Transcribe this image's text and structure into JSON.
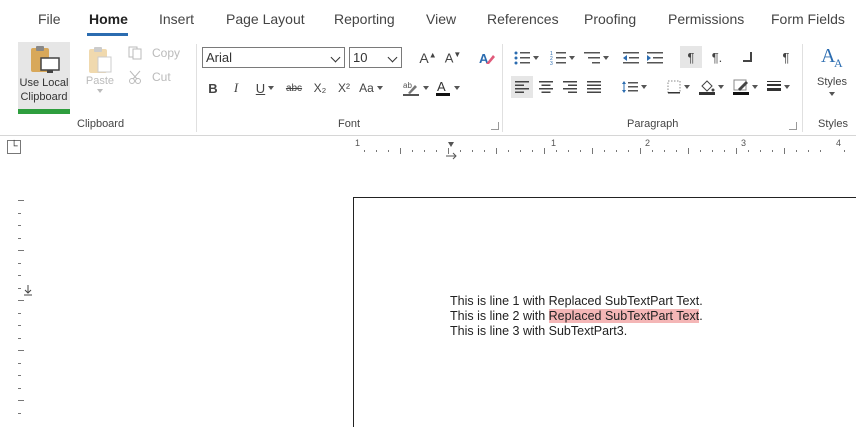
{
  "tabs": [
    {
      "label": "File"
    },
    {
      "label": "Home"
    },
    {
      "label": "Insert"
    },
    {
      "label": "Page Layout"
    },
    {
      "label": "Reporting"
    },
    {
      "label": "View"
    },
    {
      "label": "References"
    },
    {
      "label": "Proofing"
    },
    {
      "label": "Permissions"
    },
    {
      "label": "Form Fields"
    }
  ],
  "clipboard": {
    "use_local_line1": "Use Local",
    "use_local_line2": "Clipboard",
    "paste": "Paste",
    "copy": "Copy",
    "cut": "Cut",
    "group_label": "Clipboard"
  },
  "font": {
    "family": "Arial",
    "size": "10",
    "group_label": "Font",
    "bold": "B",
    "italic": "I",
    "underline": "U",
    "strikethrough": "abc",
    "subscript": "X₂",
    "superscript": "X²",
    "change_case": "Aa"
  },
  "paragraph": {
    "group_label": "Paragraph"
  },
  "styles": {
    "label": "Styles",
    "group_label": "Styles"
  },
  "ruler": {
    "marks": [
      "1",
      "1",
      "2",
      "3",
      "4"
    ]
  },
  "document": {
    "line1": "This is line 1 with Replaced SubTextPart Text.",
    "line2_prefix": "This is line 2 with ",
    "line2_highlight": "Replaced SubTextPart Text",
    "line2_suffix": ".",
    "line3": "This is line 3 with SubTextPart3."
  },
  "colors": {
    "accent": "#2b6cb0",
    "clipboard_active": "#2e9e3e",
    "highlight": "#f4b6b6"
  }
}
